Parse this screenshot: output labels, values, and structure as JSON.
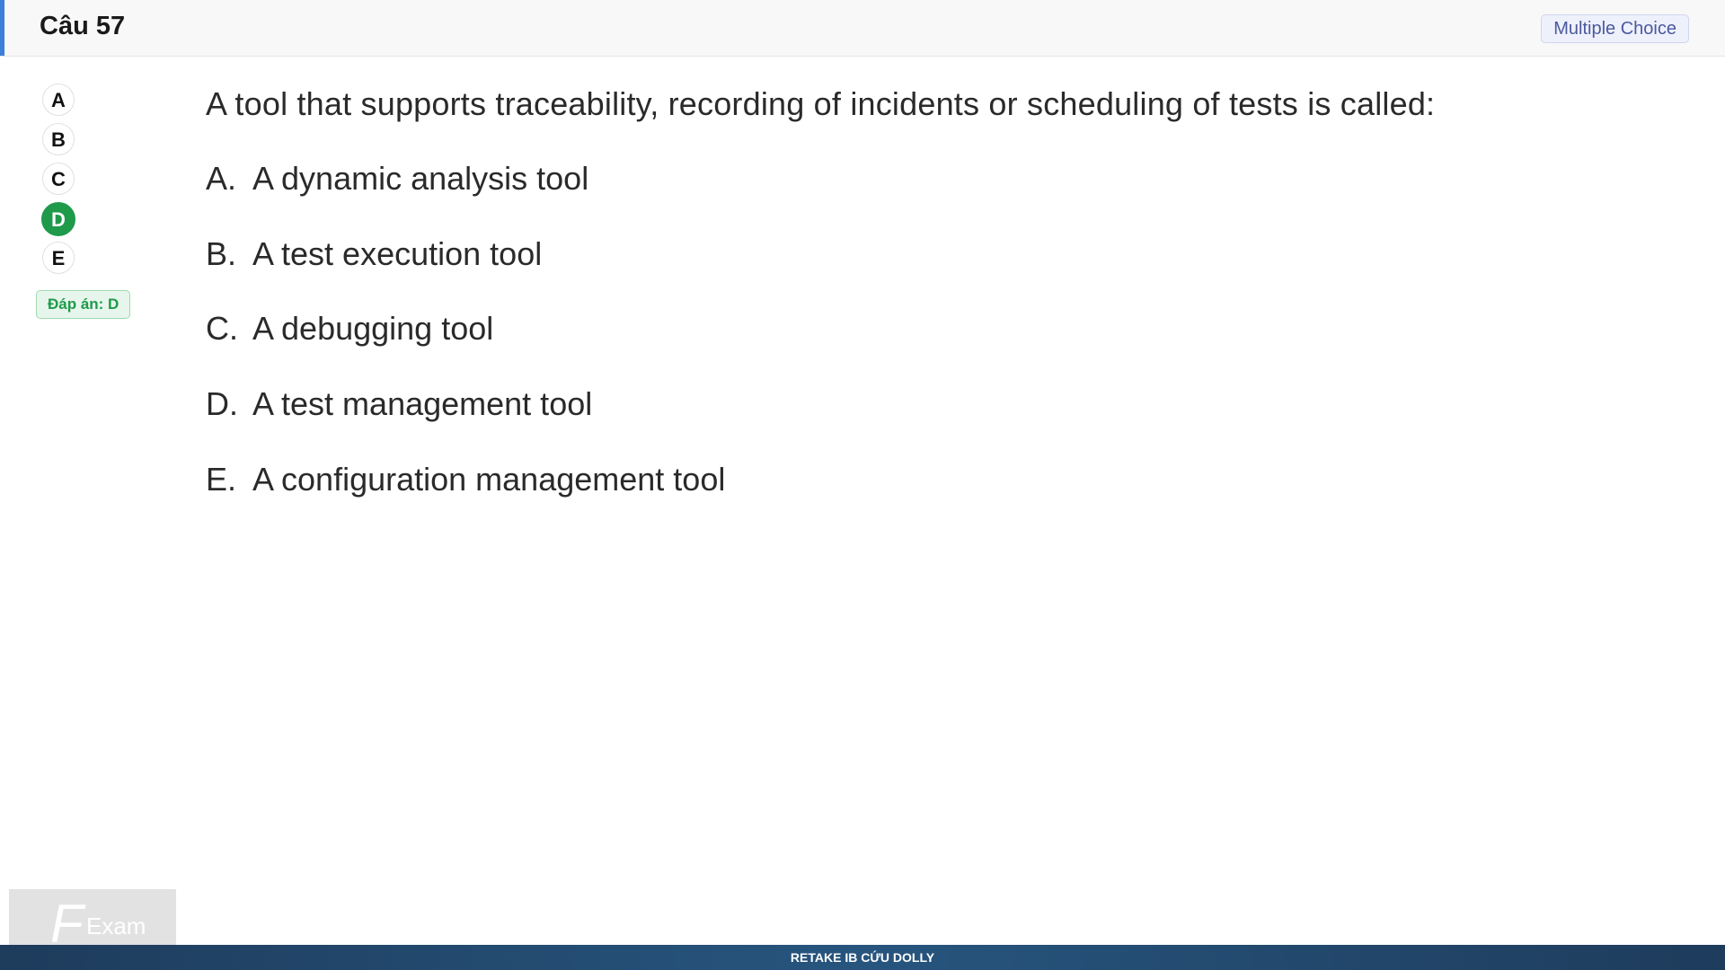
{
  "header": {
    "title": "Câu 57",
    "type_badge": "Multiple Choice",
    "accent_color": "#3b7fd8"
  },
  "sidebar": {
    "options": [
      {
        "label": "A",
        "selected": false
      },
      {
        "label": "B",
        "selected": false
      },
      {
        "label": "C",
        "selected": false
      },
      {
        "label": "D",
        "selected": true
      },
      {
        "label": "E",
        "selected": false
      }
    ],
    "answer_badge": "Đáp án: D",
    "selected_color": "#1f9a4b"
  },
  "question": {
    "text": "A tool that supports traceability, recording of incidents or scheduling of tests is called:",
    "choices": [
      {
        "letter": "A.",
        "text": "A dynamic analysis tool"
      },
      {
        "letter": "B.",
        "text": "A test execution tool"
      },
      {
        "letter": "C.",
        "text": "A debugging tool"
      },
      {
        "letter": "D.",
        "text": "A test management tool"
      },
      {
        "letter": "E.",
        "text": "A configuration management tool"
      }
    ]
  },
  "watermark": {
    "text": "Exam",
    "logo_letter": "F"
  },
  "footer": {
    "text": "RETAKE IB CỨU DOLLY"
  }
}
